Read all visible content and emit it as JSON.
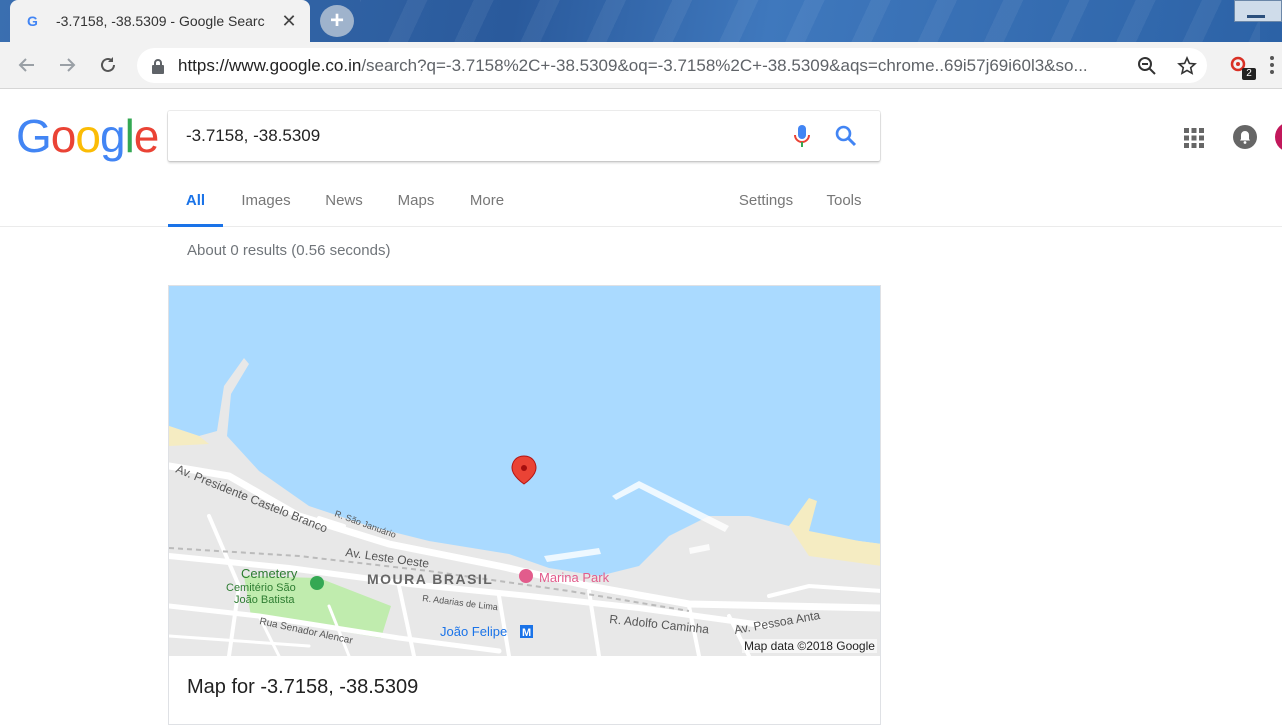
{
  "browser": {
    "tab_title": "-3.7158, -38.5309 - Google Searc",
    "tab_close": "✕",
    "new_tab": "+",
    "url_prefix": "https://www.google.co.in",
    "url_path": "/search?q=-3.7158%2C+-38.5309&oq=-3.7158%2C+-38.5309&aqs=chrome..69i57j69i60l3&so...",
    "extension_badge": "2"
  },
  "search": {
    "query": "-3.7158, -38.5309"
  },
  "logo": [
    "G",
    "o",
    "o",
    "g",
    "l",
    "e"
  ],
  "nav": {
    "tabs": [
      "All",
      "Images",
      "News",
      "Maps",
      "More"
    ],
    "settings": "Settings",
    "tools": "Tools"
  },
  "results": {
    "stats": "About 0 results (0.56 seconds)"
  },
  "map": {
    "caption": "Map for -3.7158, -38.5309",
    "attribution": "Map data ©2018 Google",
    "labels": {
      "presidente": "Av. Presidente Castelo Branco",
      "sao_januario": "R. São Januário",
      "leste_oeste": "Av. Leste Oeste",
      "cemetery": "Cemetery",
      "cemiterio1": "Cemitério São",
      "cemiterio2": "João Batista",
      "moura_brasil": "MOURA BRASIL",
      "marina_park": "Marina Park",
      "adarias": "R. Adarias de Lima",
      "senador": "Rua Senador Alencar",
      "joao_felipe": "João Felipe",
      "metro": "M",
      "adolfo": "R. Adolfo Caminha",
      "pessoa": "Av. Pessoa Anta"
    },
    "colors": {
      "water": "#aadaff",
      "land": "#e8e8e8",
      "park": "#c0ecae",
      "beach": "#f5ecc2",
      "pin": "#ea4335"
    }
  },
  "colors": {
    "blue": "#4285f4",
    "red": "#ea4335",
    "yellow": "#fbbc05",
    "green": "#34a853",
    "active_tab": "#1a73e8"
  }
}
